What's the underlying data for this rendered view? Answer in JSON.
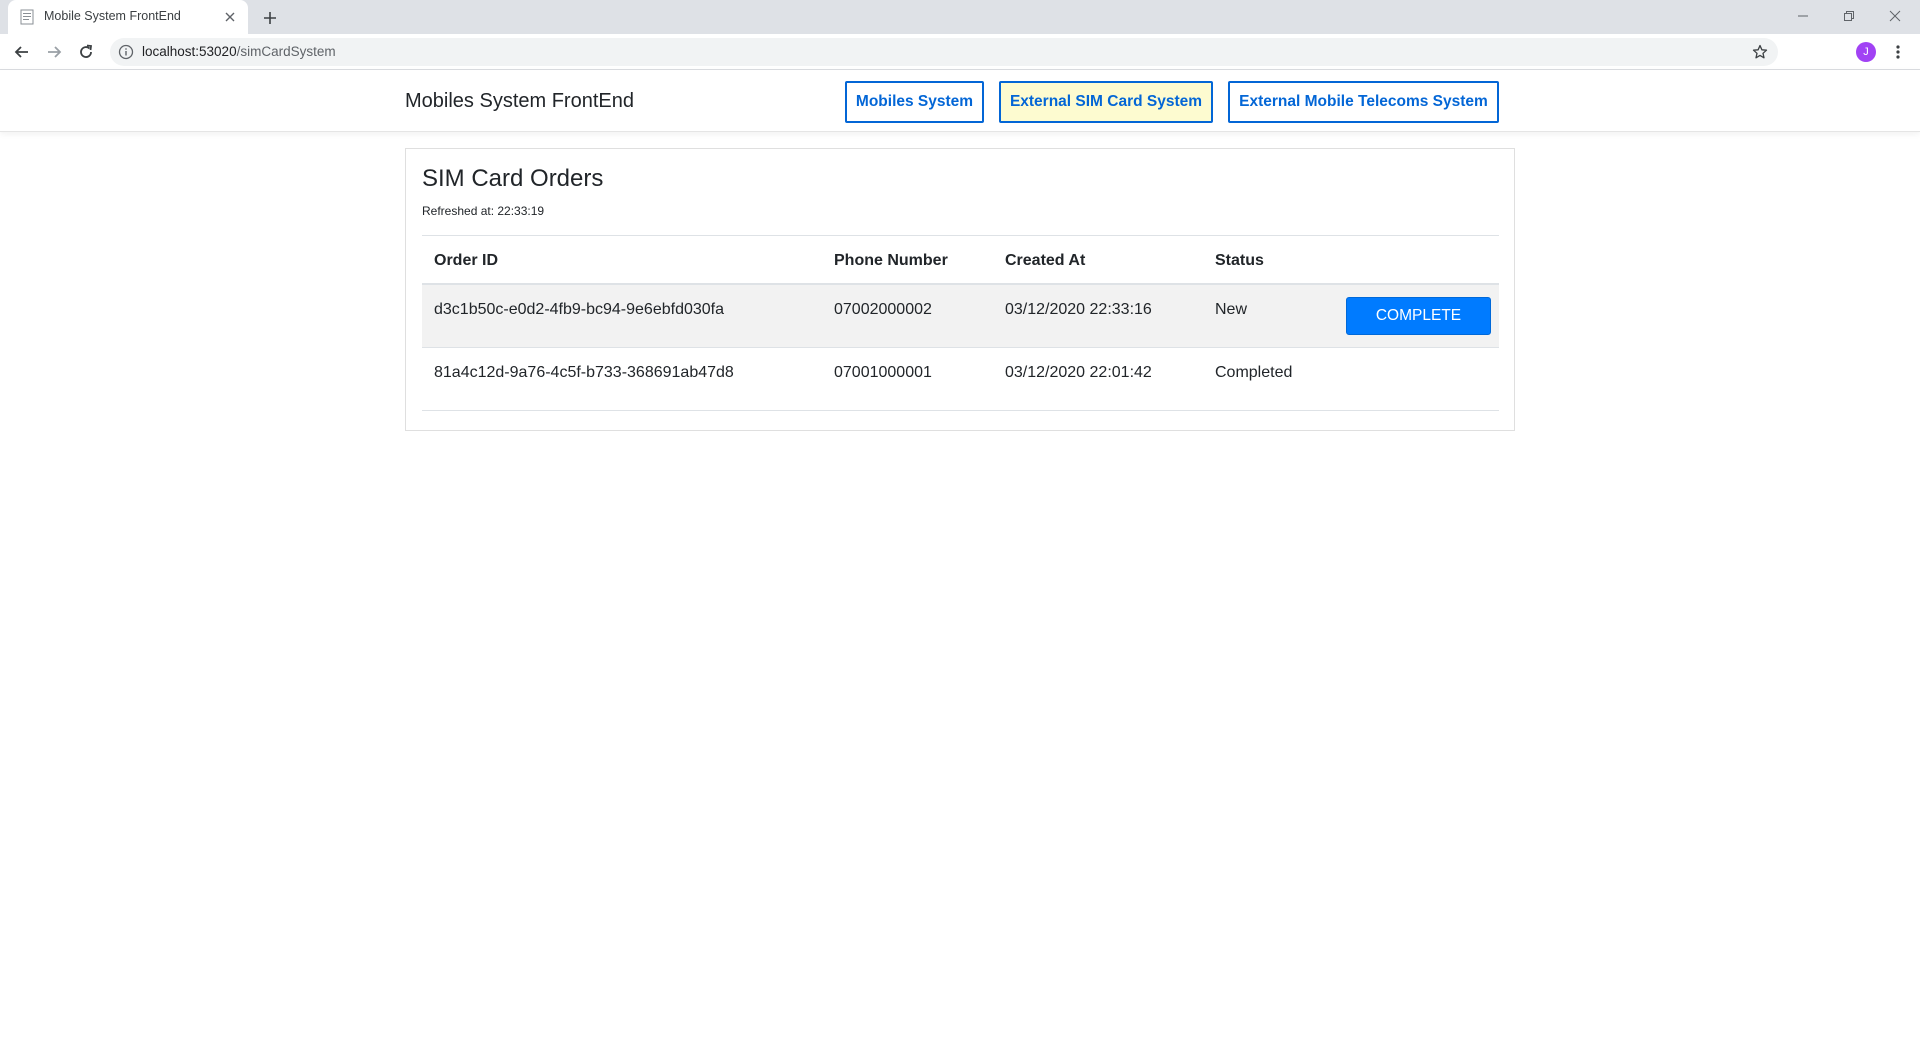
{
  "browser": {
    "tab_title": "Mobile System FrontEnd",
    "url_host": "localhost:53020",
    "url_path": "/simCardSystem",
    "profile_initial": "J"
  },
  "navbar": {
    "brand": "Mobiles System FrontEnd",
    "links": [
      {
        "label": "Mobiles System",
        "active": false
      },
      {
        "label": "External SIM Card System",
        "active": true
      },
      {
        "label": "External Mobile Telecoms System",
        "active": false
      }
    ]
  },
  "main": {
    "title": "SIM Card Orders",
    "refreshed": "Refreshed at: 22:33:19",
    "columns": [
      "Order ID",
      "Phone Number",
      "Created At",
      "Status"
    ],
    "rows": [
      {
        "order_id": "d3c1b50c-e0d2-4fb9-bc94-9e6ebfd030fa",
        "phone": "07002000002",
        "created_at": "03/12/2020 22:33:16",
        "status": "New",
        "action": "COMPLETE"
      },
      {
        "order_id": "81a4c12d-9a76-4c5f-b733-368691ab47d8",
        "phone": "07001000001",
        "created_at": "03/12/2020 22:01:42",
        "status": "Completed",
        "action": ""
      }
    ]
  },
  "colors": {
    "link_blue": "#0366d6",
    "active_bg": "#fdfbd0",
    "button_blue": "#007bff"
  },
  "icons": [
    "page-favicon-icon",
    "close-icon",
    "plus-icon",
    "minimize-icon",
    "restore-icon",
    "window-close-icon",
    "back-arrow-icon",
    "forward-arrow-icon",
    "reload-icon",
    "info-icon",
    "star-icon",
    "more-vert-icon"
  ]
}
